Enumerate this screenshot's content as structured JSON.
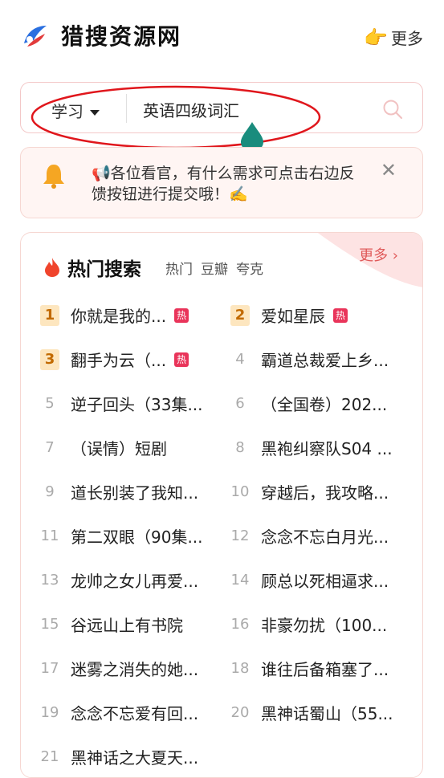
{
  "header": {
    "site_title": "猎搜资源网",
    "more_label": "更多",
    "more_icon": "pointing-hand-icon"
  },
  "search": {
    "category": "学习",
    "query": "英语四级词汇"
  },
  "notice": {
    "text": "📢各位看官，有什么需求可点击右边反馈按钮进行提交哦！✍️"
  },
  "hot": {
    "title": "热门搜索",
    "tabs": [
      "热门",
      "豆瓣",
      "夸克"
    ],
    "more_label": "更多 ›",
    "badge_label": "热",
    "items": [
      {
        "rank": "1",
        "text": "你就是我的...",
        "hot": true
      },
      {
        "rank": "2",
        "text": "爱如星辰",
        "hot": true
      },
      {
        "rank": "3",
        "text": "翻手为云（...",
        "hot": true
      },
      {
        "rank": "4",
        "text": "霸道总裁爱上乡...",
        "hot": false
      },
      {
        "rank": "5",
        "text": "逆子回头（33集...",
        "hot": false
      },
      {
        "rank": "6",
        "text": "（全国卷）202...",
        "hot": false
      },
      {
        "rank": "7",
        "text": "（误情）短剧",
        "hot": false
      },
      {
        "rank": "8",
        "text": "黑袍纠察队S04 ...",
        "hot": false
      },
      {
        "rank": "9",
        "text": "道长别装了我知...",
        "hot": false
      },
      {
        "rank": "10",
        "text": "穿越后，我攻略...",
        "hot": false
      },
      {
        "rank": "11",
        "text": "第二双眼（90集...",
        "hot": false
      },
      {
        "rank": "12",
        "text": "念念不忘白月光...",
        "hot": false
      },
      {
        "rank": "13",
        "text": "龙帅之女儿再爱...",
        "hot": false
      },
      {
        "rank": "14",
        "text": "顾总以死相逼求...",
        "hot": false
      },
      {
        "rank": "15",
        "text": "谷远山上有书院",
        "hot": false
      },
      {
        "rank": "16",
        "text": "非豪勿扰（100...",
        "hot": false
      },
      {
        "rank": "17",
        "text": "迷雾之消失的她...",
        "hot": false
      },
      {
        "rank": "18",
        "text": "谁往后备箱塞了...",
        "hot": false
      },
      {
        "rank": "19",
        "text": "念念不忘爱有回...",
        "hot": false
      },
      {
        "rank": "20",
        "text": "黑神话蜀山（55...",
        "hot": false
      },
      {
        "rank": "21",
        "text": "黑神话之大夏天...",
        "hot": false
      }
    ]
  },
  "colors": {
    "accent_red": "#e05a5a",
    "badge_red": "#e9345a",
    "top_rank_bg": "#fde6bf",
    "annotation_red": "#e0161c",
    "drop_teal": "#1a8c7d"
  }
}
